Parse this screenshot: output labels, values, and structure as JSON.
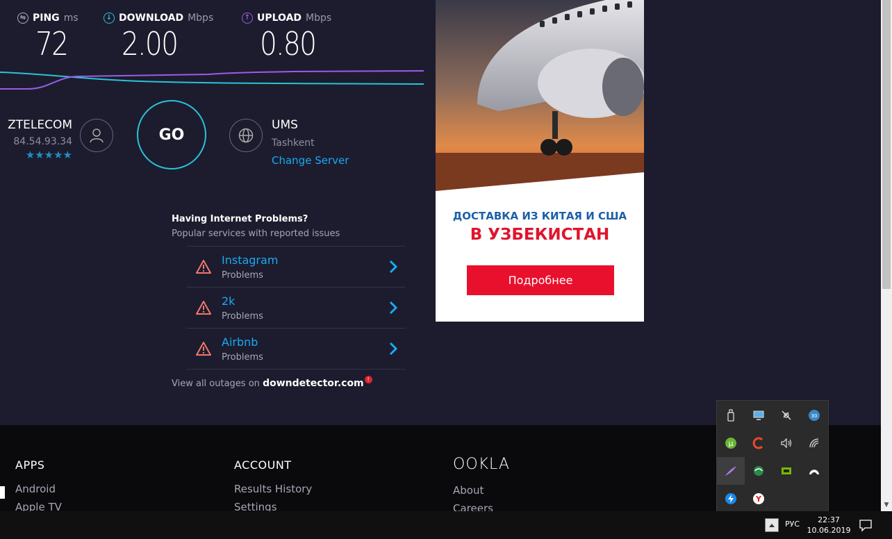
{
  "speedtest": {
    "ping": {
      "label": "PING",
      "unit": "ms",
      "value": "72"
    },
    "download": {
      "label": "DOWNLOAD",
      "unit": "Mbps",
      "value": "2.00"
    },
    "upload": {
      "label": "UPLOAD",
      "unit": "Mbps",
      "value": "0.80"
    },
    "isp": {
      "name": "ZTELECOM",
      "ip": "84.54.93.34",
      "rating": "★★★★★"
    },
    "go_label": "GO",
    "server": {
      "name": "UMS",
      "location": "Tashkent",
      "change_label": "Change Server"
    },
    "colors": {
      "download": "#2ac3d8",
      "upload": "#9b5de5",
      "accent": "#1aaaf2"
    }
  },
  "problems": {
    "title": "Having Internet Problems?",
    "subtitle": "Popular services with reported issues",
    "items": [
      {
        "name": "Instagram",
        "status": "Problems"
      },
      {
        "name": "2k",
        "status": "Problems"
      },
      {
        "name": "Airbnb",
        "status": "Problems"
      }
    ],
    "outages_text": "View all outages on",
    "outages_site": "downdetector.com",
    "badge": "!"
  },
  "ad": {
    "line1": "ДОСТАВКА ИЗ КИТАЯ И США",
    "line2": "В УЗБЕКИСТАН",
    "button": "Подробнее"
  },
  "footer": {
    "apps": {
      "heading": "APPS",
      "links": [
        "Android",
        "Apple TV"
      ]
    },
    "account": {
      "heading": "ACCOUNT",
      "links": [
        "Results History",
        "Settings"
      ]
    },
    "ookla": {
      "logo": "OOKLA",
      "links": [
        "About",
        "Careers"
      ]
    }
  },
  "tray": {
    "icons": [
      "usb-drive-icon",
      "display-icon",
      "satellite-icon",
      "weather-30-icon",
      "utorrent-icon",
      "cleaner-icon",
      "volume-icon",
      "wifi-icon",
      "feather-icon",
      "cloud-sync-icon",
      "nvidia-icon",
      "game-icon",
      "thunder-icon",
      "yandex-icon"
    ],
    "badge_30": "30"
  },
  "taskbar": {
    "lang": "РУС",
    "time": "22:37",
    "date": "10.06.2019"
  }
}
